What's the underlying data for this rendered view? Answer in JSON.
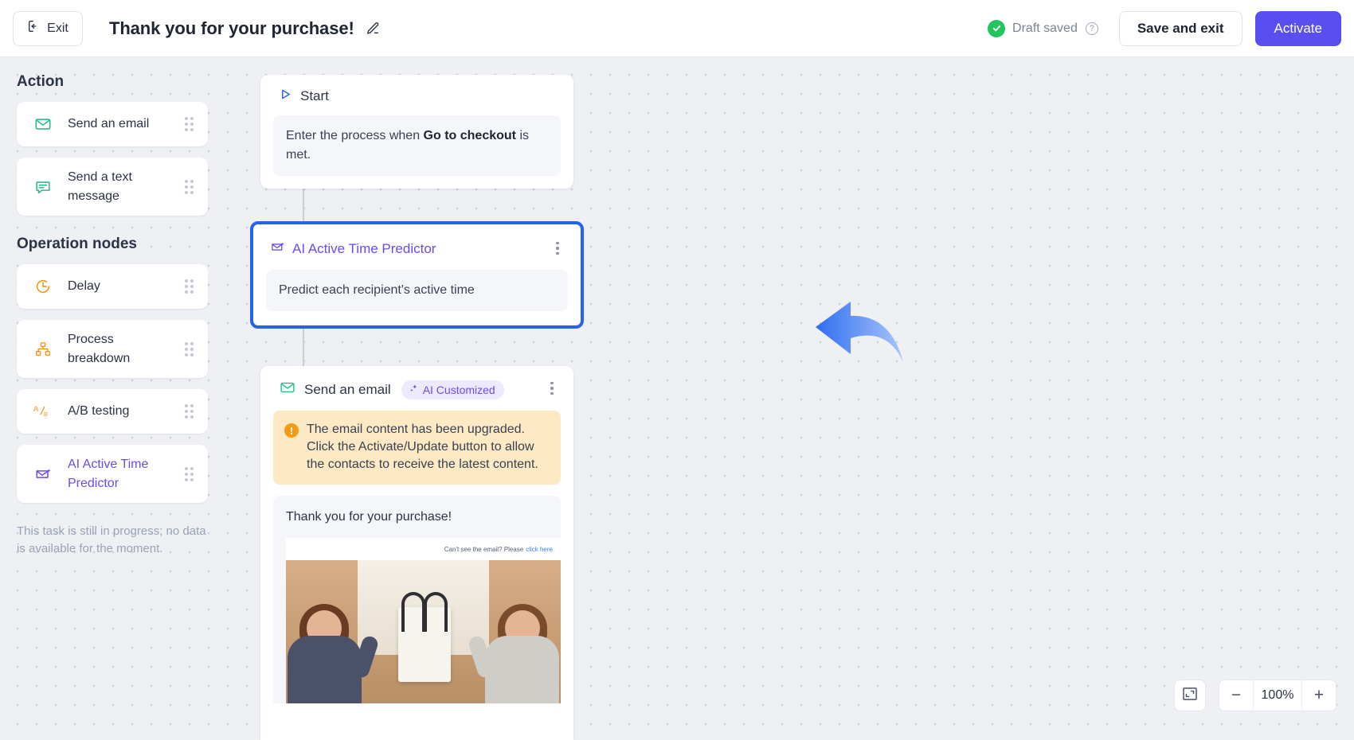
{
  "header": {
    "exit_label": "Exit",
    "title": "Thank you for your purchase!",
    "edit_icon": "pencil-icon",
    "draft_status": "Draft saved",
    "help_glyph": "?",
    "save_label": "Save and exit",
    "activate_label": "Activate",
    "accent_color": "#5b4ef0",
    "success_color": "#22c55e"
  },
  "sidebar": {
    "sections": [
      {
        "heading": "Action",
        "items": [
          {
            "label": "Send an email",
            "icon": "envelope-icon",
            "color": "#2bb98a",
            "highlight": false
          },
          {
            "label": "Send a text message",
            "icon": "message-bubble-icon",
            "color": "#2bb98a",
            "highlight": false
          }
        ]
      },
      {
        "heading": "Operation nodes",
        "items": [
          {
            "label": "Delay",
            "icon": "clock-icon",
            "color": "#f59a16",
            "highlight": false
          },
          {
            "label": "Process breakdown",
            "icon": "hierarchy-icon",
            "color": "#f59a16",
            "highlight": false
          },
          {
            "label": "A/B testing",
            "icon": "ab-test-icon",
            "color": "#f59a16",
            "highlight": false
          },
          {
            "label": "AI Active Time Predictor",
            "icon": "ai-envelope-icon",
            "color": "#6d4aee",
            "highlight": true
          }
        ]
      }
    ],
    "note": "This task is still in progress; no data is available for the moment."
  },
  "flow": {
    "nodes": [
      {
        "id": "start",
        "title": "Start",
        "icon": "play-triangle-icon",
        "body_prefix": "Enter the process when ",
        "body_bold": "Go to checkout",
        "body_suffix": " is met."
      },
      {
        "id": "ai-predictor",
        "title": "AI Active Time Predictor",
        "icon": "ai-envelope-icon",
        "body": "Predict each recipient's active time",
        "selected": true,
        "selection_color": "#2563eb"
      },
      {
        "id": "send-email",
        "title": "Send an email",
        "icon": "envelope-icon",
        "badge": "AI Customized",
        "badge_icon": "sparkle-icon",
        "warning": "The email content has been upgraded. Click the Activate/Update button to allow the contacts to receive the latest content.",
        "preview_subject": "Thank you for your purchase!",
        "email_preview_header": "Can't see the email? Please",
        "email_preview_link": "click here"
      }
    ]
  },
  "zoom_controls": {
    "fit_icon": "fit-to-screen-icon",
    "minus_label": "−",
    "level": "100%",
    "plus_label": "+"
  }
}
